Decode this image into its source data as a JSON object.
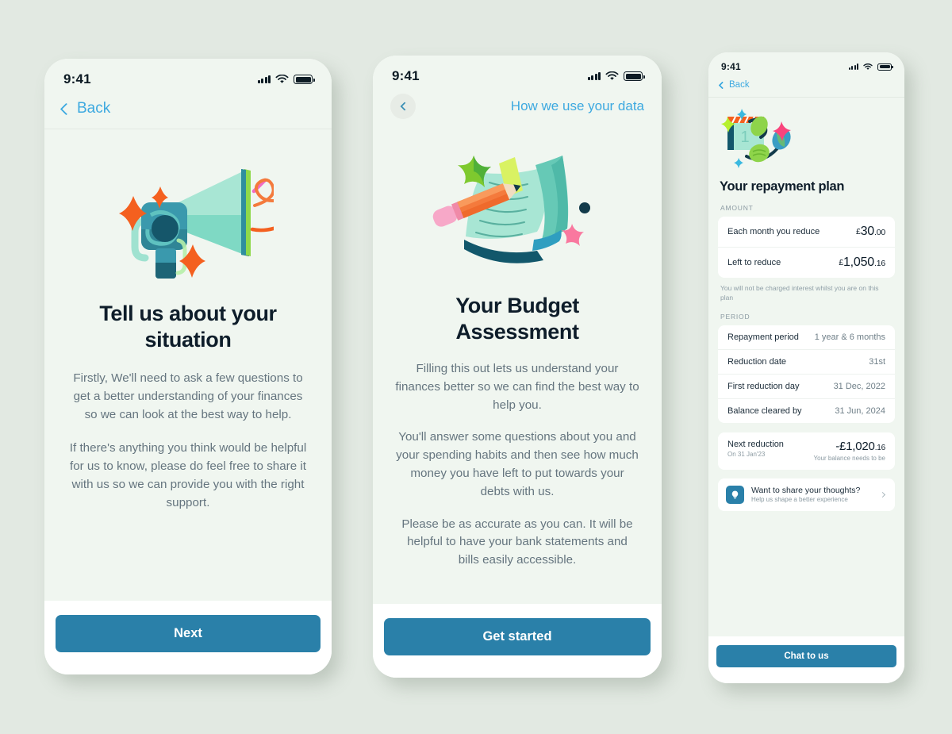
{
  "statusbar": {
    "time": "9:41",
    "icons": [
      "cellular-signal-icon",
      "wifi-icon",
      "battery-icon"
    ]
  },
  "colors": {
    "page_background": "#e2e9e2",
    "screen_background": "#f0f6f0",
    "primary_button": "#2a80a9",
    "link_blue": "#3da9e0",
    "heading": "#0e1d2a",
    "body_text": "#65757f",
    "card_white": "#ffffff"
  },
  "screens": [
    {
      "id": "tell-us-about-your-situation",
      "nav": {
        "back_label": "Back"
      },
      "illustration": "megaphone-illustration",
      "title": "Tell us about your situation",
      "paragraphs": [
        "Firstly, We'll need to ask a few questions to get a better understanding of your finances so we can look at the best way to help.",
        "If there's anything you think would be helpful for us to know, please do feel free to share it with us so we can provide you with the right support."
      ],
      "cta": "Next"
    },
    {
      "id": "your-budget-assessment",
      "nav": {
        "title": "How we use your data"
      },
      "illustration": "notebook-and-pencil-illustration",
      "title": "Your Budget Assessment",
      "paragraphs": [
        "Filling this out lets us understand your finances better so we can find the best way to help you.",
        "You'll answer some questions about you and your spending habits and then see how much money you have left to put towards your debts with us.",
        "Please be as accurate as you can. It will be helpful to have your bank statements and bills easily accessible."
      ],
      "cta": "Get started"
    },
    {
      "id": "your-repayment-plan",
      "nav": {
        "back_label": "Back"
      },
      "illustration": "calendar-and-leaves-illustration",
      "title": "Your repayment plan",
      "amount_section": {
        "label": "AMOUNT",
        "rows": [
          {
            "label": "Each month you reduce",
            "currency": "£",
            "whole": "30",
            "decimals": ".00"
          },
          {
            "label": "Left to reduce",
            "currency": "£",
            "whole": "1,050",
            "decimals": ".16"
          }
        ],
        "note": "You will not be charged interest whilst you are on this plan"
      },
      "period_section": {
        "label": "PERIOD",
        "rows": [
          {
            "label": "Repayment period",
            "value": "1 year & 6 months"
          },
          {
            "label": "Reduction date",
            "value": "31st"
          },
          {
            "label": "First reduction day",
            "value": "31 Dec, 2022"
          },
          {
            "label": "Balance cleared by",
            "value": "31 Jun, 2024"
          }
        ]
      },
      "next_reduction": {
        "title": "Next reduction",
        "subtitle": "On 31 Jan'23",
        "amount_whole": "-£1,020",
        "amount_decimals": ".16",
        "amount_caption": "Your balance needs to be"
      },
      "feedback": {
        "icon": "lightbulb-icon",
        "title": "Want to share your thoughts?",
        "subtitle": "Help us shape a better experience"
      },
      "cta": "Chat to us"
    }
  ]
}
